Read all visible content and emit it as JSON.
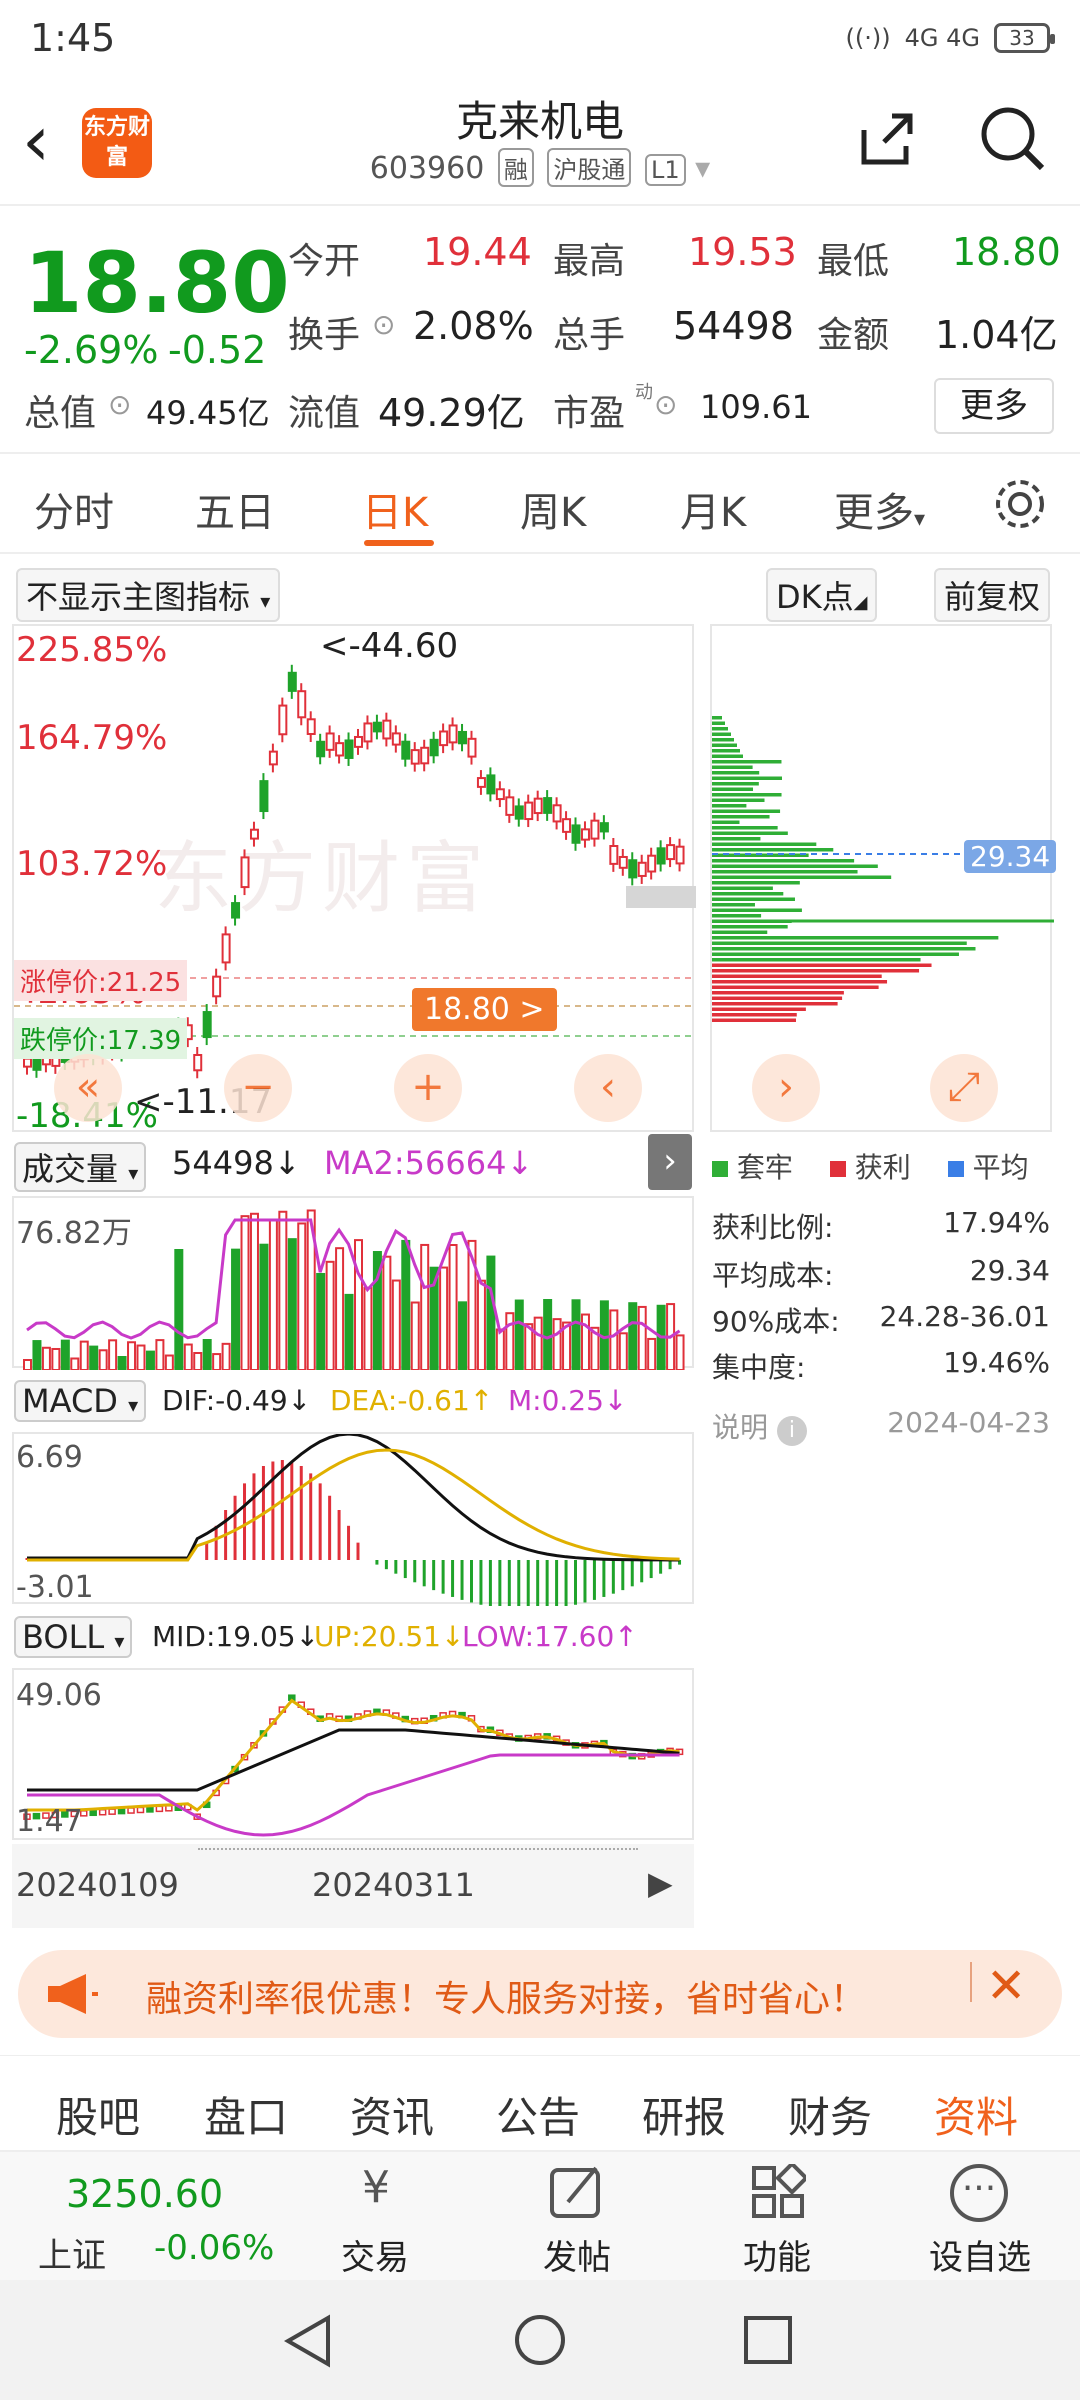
{
  "status": {
    "time": "1:45",
    "signal": "4G 4G",
    "battery": "33"
  },
  "header": {
    "logo_text": "东方财富",
    "title": "克来机电",
    "code": "603960",
    "tags": [
      "融",
      "沪股通",
      "L1"
    ]
  },
  "quote": {
    "price": "18.80",
    "change_pct": "-2.69%",
    "change": "-0.52",
    "open_label": "今开",
    "open": "19.44",
    "high_label": "最高",
    "high": "19.53",
    "low_label": "最低",
    "low": "18.80",
    "turnover_label": "换手",
    "turnover": "2.08%",
    "volume_label": "总手",
    "volume": "54498",
    "amount_label": "金额",
    "amount": "1.04亿",
    "mktcap_label": "总值",
    "mktcap": "49.45亿",
    "float_label": "流值",
    "float": "49.29亿",
    "pe_label": "市盈",
    "pe_sup": "动",
    "pe": "109.61",
    "more": "更多"
  },
  "tabs": [
    "分时",
    "五日",
    "日K",
    "周K",
    "月K",
    "更多"
  ],
  "toolbar": {
    "indicator": "不显示主图指标",
    "dk": "DK点",
    "adjust": "前复权"
  },
  "main_chart": {
    "y_labels": [
      "225.85%",
      "164.79%",
      "103.72%",
      "42.65%",
      "-18.41%"
    ],
    "max_label": "<-44.60",
    "min_label": "<-11.17",
    "limit_up": "涨停价:21.25",
    "limit_down": "跌停价:17.39",
    "current": "18.80 >",
    "watermark": "东方财富",
    "cost_label": "29.34"
  },
  "volume": {
    "label": "成交量",
    "value": "54498↓",
    "ma2": "MA2:56664↓",
    "axis": "76.82万"
  },
  "macd": {
    "label": "MACD",
    "dif": "DIF:-0.49↓",
    "dea": "DEA:-0.61↑",
    "m": "M:0.25↓",
    "top": "6.69",
    "bottom": "-3.01"
  },
  "boll": {
    "label": "BOLL",
    "mid": "MID:19.05↓",
    "up": "UP:20.51↓",
    "low": "LOW:17.60↑",
    "top": "49.06",
    "bottom": "1.47"
  },
  "dates": [
    "20240109",
    "20240311"
  ],
  "chips": {
    "legend": [
      "套牢",
      "获利",
      "平均"
    ],
    "legend_colors": [
      "#2fae36",
      "#e0303a",
      "#3a7ee6"
    ],
    "stats": [
      {
        "label": "获利比例:",
        "value": "17.94%"
      },
      {
        "label": "平均成本:",
        "value": "29.34"
      },
      {
        "label": "90%成本:",
        "value": "24.28-36.01"
      },
      {
        "label": "集中度:",
        "value": "19.46%"
      }
    ],
    "note": "说明",
    "date": "2024-04-23"
  },
  "promo": "融资利率很优惠！专人服务对接，省时省心！",
  "bottom_tabs": [
    "股吧",
    "盘口",
    "资讯",
    "公告",
    "研报",
    "财务",
    "资料"
  ],
  "bottom_bar": {
    "index_value": "3250.60",
    "index_name": "上证",
    "index_change": "-0.06%",
    "items": [
      "交易",
      "发帖",
      "功能",
      "设自选"
    ]
  }
}
